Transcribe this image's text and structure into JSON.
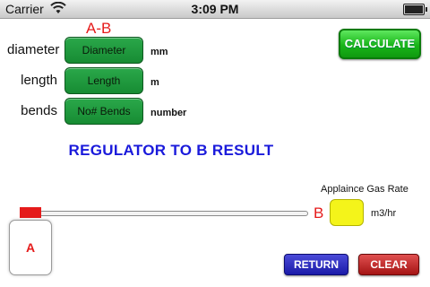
{
  "status_bar": {
    "carrier": "Carrier",
    "time": "3:09 PM",
    "wifi_icon": "wifi-icon",
    "battery_icon": "battery-icon",
    "battery_level": 1.0
  },
  "section_label": "A-B",
  "fields": [
    {
      "label": "diameter",
      "placeholder": "Diameter",
      "unit": "mm"
    },
    {
      "label": "length",
      "placeholder": "Length",
      "unit": "m"
    },
    {
      "label": "bends",
      "placeholder": "No# Bends",
      "unit": "number"
    }
  ],
  "calculate_label": "CALCULATE",
  "result_title": "REGULATOR TO B RESULT",
  "gas_rate": {
    "label": "Applaince Gas Rate",
    "point_label": "B",
    "value": "",
    "unit": "m3/hr"
  },
  "diagram": {
    "start_label": "A"
  },
  "buttons": {
    "return_label": "RETURN",
    "clear_label": "CLEAR"
  },
  "colors": {
    "field_green": "#1f9a3e",
    "calculate_green": "#19b519",
    "title_blue": "#1a1adb",
    "accent_red": "#e51b1b",
    "gas_rate_yellow": "#f4f41a",
    "return_blue": "#1a1aa8",
    "clear_red": "#a51414"
  }
}
